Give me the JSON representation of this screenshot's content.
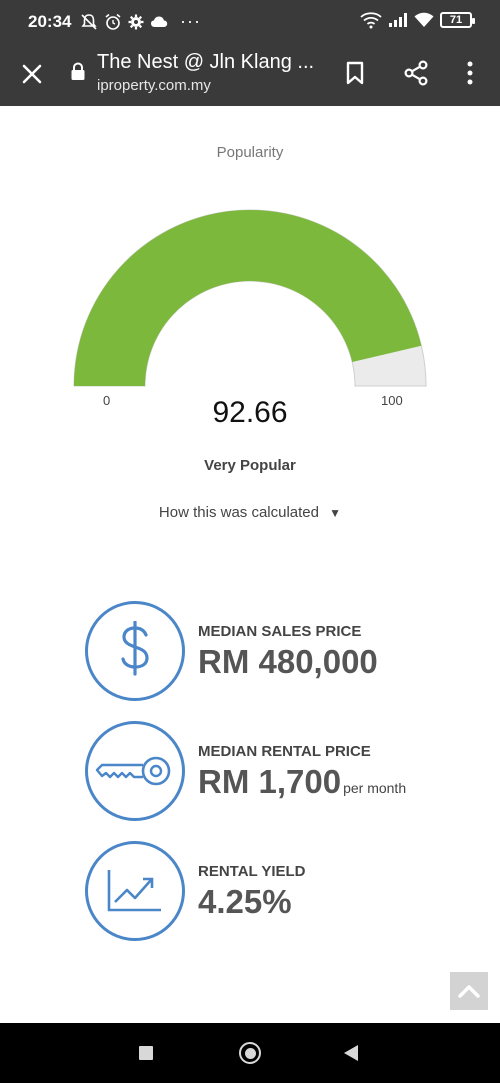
{
  "status_bar": {
    "time": "20:34",
    "battery": "71",
    "icons_left": [
      "mute-icon",
      "alarm-icon",
      "settings-icon",
      "cloud-icon",
      "more-dots-icon"
    ],
    "icons_right": [
      "wifi-calling-icon",
      "signal-icon",
      "wifi-icon",
      "battery-icon"
    ]
  },
  "toolbar": {
    "title": "The Nest @ Jln Klang ...",
    "url": "iproperty.com.my"
  },
  "gauge": {
    "title": "Popularity",
    "min": "0",
    "max": "100",
    "value": "92.66",
    "value_fraction": 0.9266,
    "label": "Very Popular",
    "calc_link": "How this was calculated",
    "calc_arrow": "▼",
    "fill_color": "#7cb83b",
    "track_color": "#ebebeb"
  },
  "stats": [
    {
      "icon": "dollar-icon",
      "label": "MEDIAN SALES PRICE",
      "value": "RM 480,000",
      "suffix": ""
    },
    {
      "icon": "key-icon",
      "label": "MEDIAN RENTAL PRICE",
      "value": "RM 1,700",
      "suffix": "per month"
    },
    {
      "icon": "trend-chart-icon",
      "label": "RENTAL YIELD",
      "value": "4.25%",
      "suffix": ""
    }
  ],
  "colors": {
    "accent_blue": "#4a86c8",
    "toolbar_bg": "#3a3a3a"
  }
}
